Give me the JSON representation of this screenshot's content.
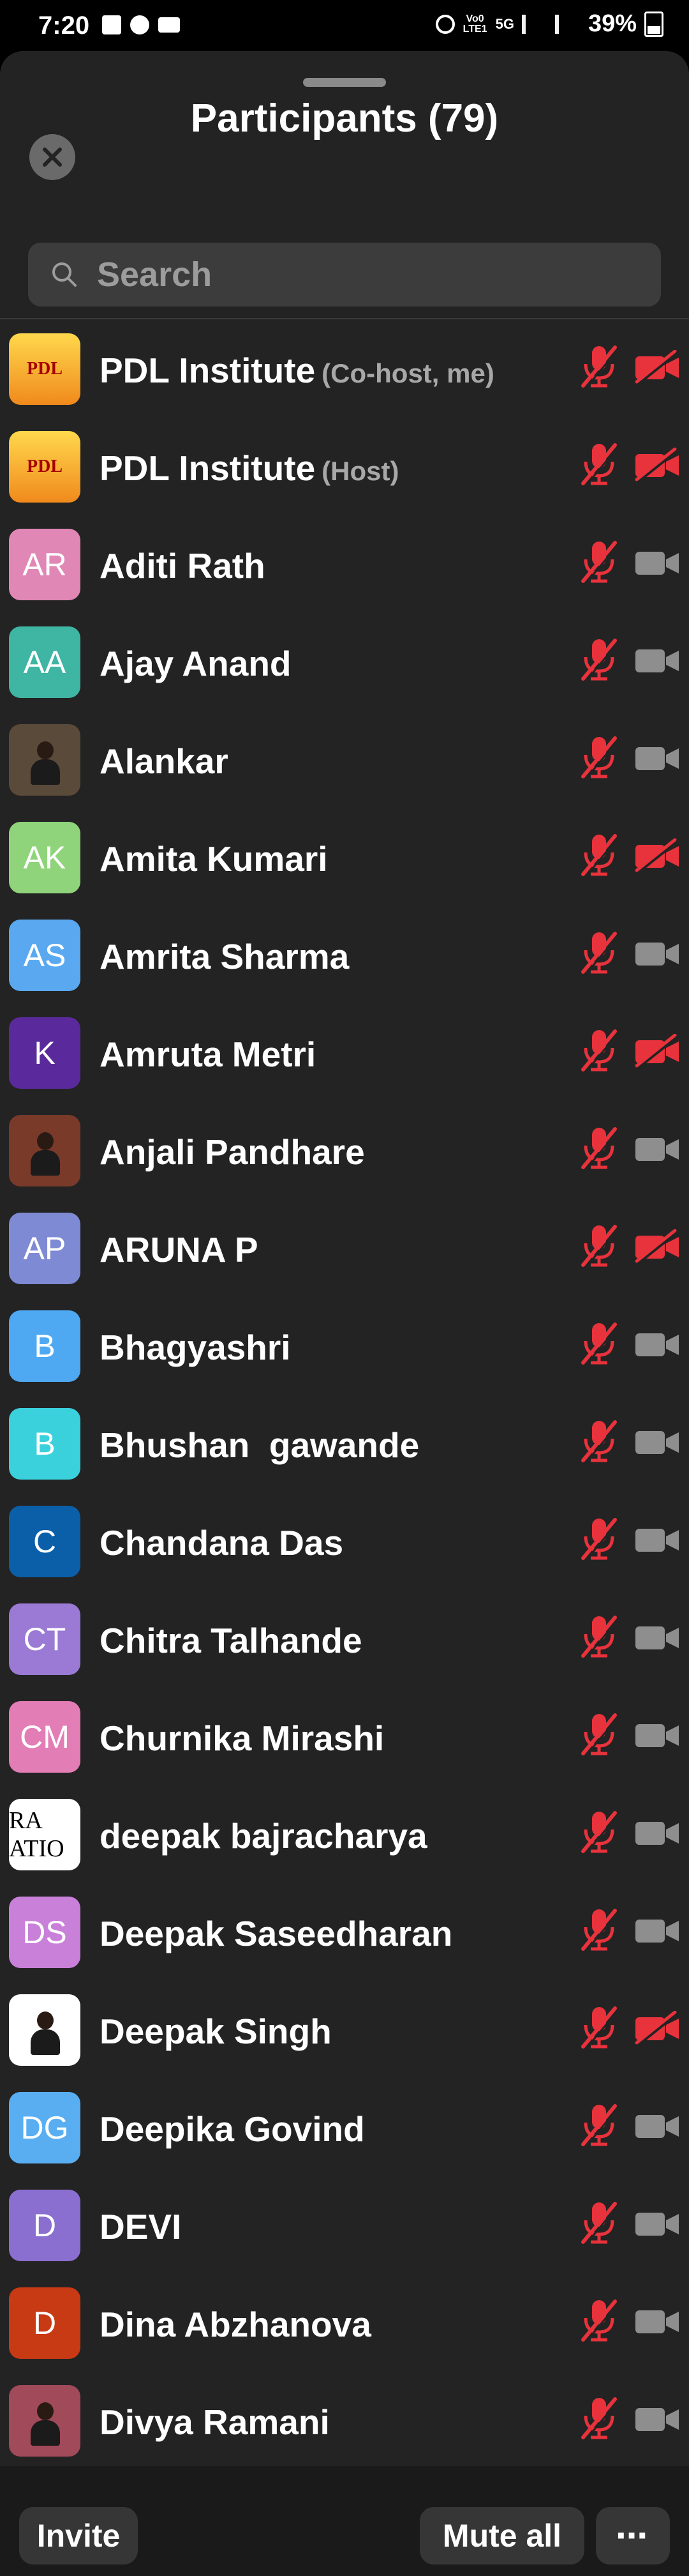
{
  "status_bar": {
    "time": "7:20",
    "network": "5G",
    "volte": "Vo0 LTE1",
    "battery": "39%"
  },
  "header": {
    "title": "Participants (79)",
    "close_icon": "close-icon"
  },
  "search": {
    "placeholder": "Search"
  },
  "colors": {
    "background": "#232323",
    "muted_red": "#e8323c",
    "camera_gray": "#8e8e8e"
  },
  "participants": [
    {
      "name": "PDL Institute",
      "role": "(Co-host, me)",
      "avatar": "PDL",
      "avatar_color": "#f4a62a",
      "mic_muted": true,
      "video_off": true
    },
    {
      "name": "PDL Institute",
      "role": "(Host)",
      "avatar": "PDL",
      "avatar_color": "#f4a62a",
      "mic_muted": true,
      "video_off": true
    },
    {
      "name": "Aditi Rath",
      "role": "",
      "avatar": "AR",
      "avatar_color": "#e087b6",
      "mic_muted": true,
      "video_off": false
    },
    {
      "name": "Ajay Anand",
      "role": "",
      "avatar": "AA",
      "avatar_color": "#3fb5a3",
      "mic_muted": true,
      "video_off": false
    },
    {
      "name": "Alankar",
      "role": "",
      "avatar": "",
      "avatar_color": "#5a4a3a",
      "mic_muted": true,
      "video_off": false
    },
    {
      "name": "Amita Kumari",
      "role": "",
      "avatar": "AK",
      "avatar_color": "#8fd47a",
      "mic_muted": true,
      "video_off": true
    },
    {
      "name": "Amrita Sharma",
      "role": "",
      "avatar": "AS",
      "avatar_color": "#5aa9f0",
      "mic_muted": true,
      "video_off": false
    },
    {
      "name": "Amruta Metri",
      "role": "",
      "avatar": "K",
      "avatar_color": "#5a2a9c",
      "mic_muted": true,
      "video_off": true
    },
    {
      "name": "Anjali Pandhare",
      "role": "",
      "avatar": "",
      "avatar_color": "#7a3a2a",
      "mic_muted": true,
      "video_off": false
    },
    {
      "name": "ARUNA P",
      "role": "",
      "avatar": "AP",
      "avatar_color": "#7f8ad4",
      "mic_muted": true,
      "video_off": true
    },
    {
      "name": "Bhagyashri",
      "role": "",
      "avatar": "B",
      "avatar_color": "#4ea8f2",
      "mic_muted": true,
      "video_off": false
    },
    {
      "name": "Bhushan  gawande",
      "role": "",
      "avatar": "B",
      "avatar_color": "#3ad1dc",
      "mic_muted": true,
      "video_off": false
    },
    {
      "name": "Chandana Das",
      "role": "",
      "avatar": "C",
      "avatar_color": "#0b5fa8",
      "mic_muted": true,
      "video_off": false
    },
    {
      "name": "Chitra Talhande",
      "role": "",
      "avatar": "CT",
      "avatar_color": "#9a7ad4",
      "mic_muted": true,
      "video_off": false
    },
    {
      "name": "Churnika Mirashi",
      "role": "",
      "avatar": "CM",
      "avatar_color": "#e27db6",
      "mic_muted": true,
      "video_off": false
    },
    {
      "name": "deepak bajracharya",
      "role": "",
      "avatar": "RA ATIO",
      "avatar_color": "#ffffff",
      "mic_muted": true,
      "video_off": false
    },
    {
      "name": "Deepak Saseedharan",
      "role": "",
      "avatar": "DS",
      "avatar_color": "#c980d9",
      "mic_muted": true,
      "video_off": false
    },
    {
      "name": "Deepak Singh",
      "role": "",
      "avatar": "",
      "avatar_color": "#ffffff",
      "mic_muted": true,
      "video_off": true
    },
    {
      "name": "Deepika Govind",
      "role": "",
      "avatar": "DG",
      "avatar_color": "#59aef2",
      "mic_muted": true,
      "video_off": false
    },
    {
      "name": "DEVI",
      "role": "",
      "avatar": "D",
      "avatar_color": "#8a6fd0",
      "mic_muted": true,
      "video_off": false
    },
    {
      "name": "Dina Abzhanova",
      "role": "",
      "avatar": "D",
      "avatar_color": "#c83a14",
      "mic_muted": true,
      "video_off": false
    },
    {
      "name": "Divya Ramani",
      "role": "",
      "avatar": "",
      "avatar_color": "#a04a5a",
      "mic_muted": true,
      "video_off": false
    }
  ],
  "bottom_bar": {
    "invite_label": "Invite",
    "mute_all_label": "Mute all",
    "more_label": "⋯"
  }
}
